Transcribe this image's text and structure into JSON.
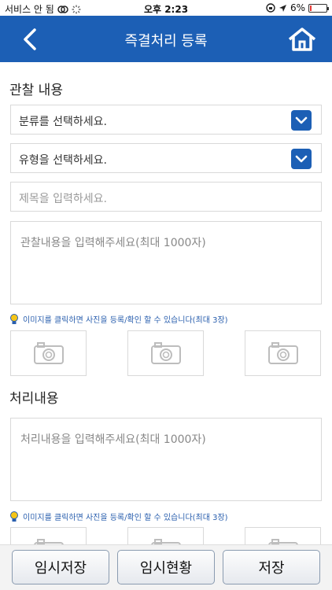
{
  "status_bar": {
    "carrier": "서비스 안 됨",
    "time": "오후 2:23",
    "battery": "6%",
    "battery_level": 0.06
  },
  "header": {
    "title": "즉결처리 등록"
  },
  "observation": {
    "section_title": "관찰 내용",
    "category_select": "분류를 선택하세요.",
    "type_select": "유형을 선택하세요.",
    "title_placeholder": "제목을 입력하세요.",
    "content_placeholder": "관찰내용을 입력해주세요(최대 1000자)",
    "photo_hint": "이미지를 클릭하면 사진을 등록/확인 할 수 있습니다(최대 3장)"
  },
  "processing": {
    "section_title": "처리내용",
    "content_placeholder": "처리내용을 입력해주세요(최대 1000자)",
    "photo_hint": "이미지를 클릭하면 사진을 등록/확인 할 수 있습니다(최대 3장)"
  },
  "bottom_bar": {
    "temp_save": "임시저장",
    "temp_status": "임시현황",
    "save": "저장"
  },
  "colors": {
    "header_bg": "#1c5fb5",
    "accent": "#1c5fb5",
    "hint_text": "#2a5fae"
  },
  "icons": [
    "back-arrow-icon",
    "home-icon",
    "chevron-down-icon",
    "lightbulb-icon",
    "camera-icon"
  ]
}
